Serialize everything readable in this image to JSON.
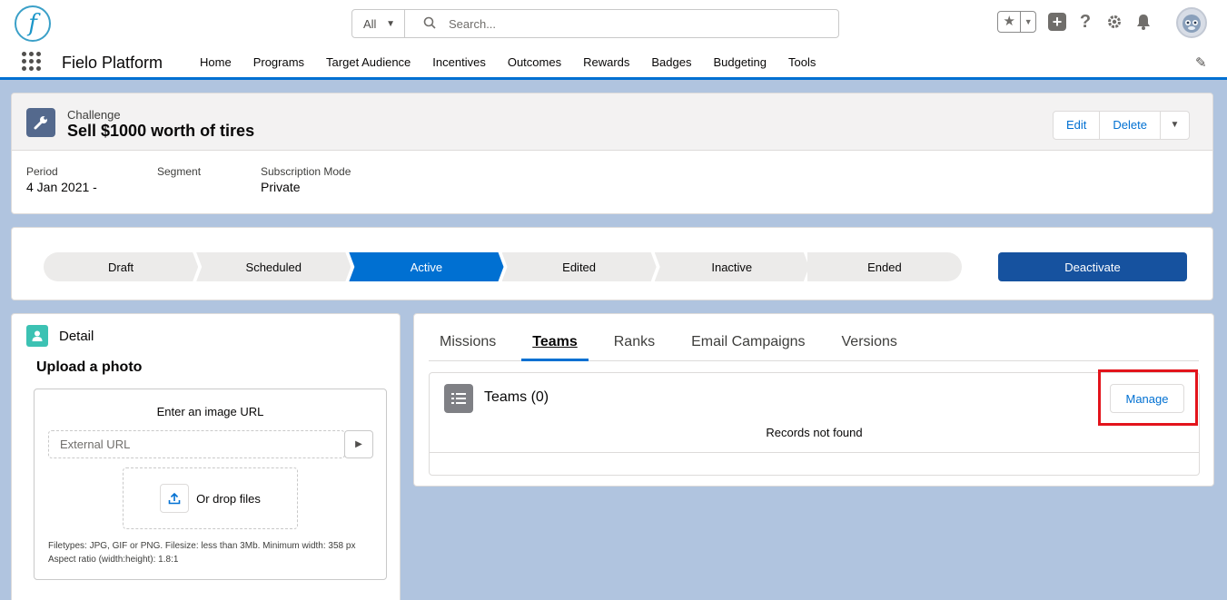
{
  "header": {
    "logo_letter": "f",
    "search_scope": "All",
    "search_placeholder": "Search...",
    "help_glyph": "?"
  },
  "nav": {
    "app_name": "Fielo Platform",
    "items": [
      "Home",
      "Programs",
      "Target Audience",
      "Incentives",
      "Outcomes",
      "Rewards",
      "Badges",
      "Budgeting",
      "Tools"
    ]
  },
  "record": {
    "object_type": "Challenge",
    "title": "Sell $1000 worth of tires",
    "buttons": {
      "edit": "Edit",
      "delete": "Delete"
    },
    "fields": {
      "period_label": "Period",
      "period_value": "4 Jan 2021 -",
      "segment_label": "Segment",
      "segment_value": "",
      "subscription_label": "Subscription Mode",
      "subscription_value": "Private"
    }
  },
  "path": {
    "stages": [
      "Draft",
      "Scheduled",
      "Active",
      "Edited",
      "Inactive",
      "Ended"
    ],
    "active_stage": "Active",
    "action_label": "Deactivate"
  },
  "detail": {
    "title": "Detail",
    "upload_title": "Upload a photo",
    "image_url_label": "Enter an image URL",
    "url_placeholder": "External URL",
    "drop_text": "Or drop files",
    "hint_line1": "Filetypes: JPG, GIF or PNG. Filesize: less than 3Mb. Minimum width: 358 px",
    "hint_line2": "Aspect ratio (width:height): 1.8:1"
  },
  "tabs": {
    "items": [
      "Missions",
      "Teams",
      "Ranks",
      "Email Campaigns",
      "Versions"
    ],
    "active": "Teams"
  },
  "related": {
    "title": "Teams (0)",
    "manage_label": "Manage",
    "empty_text": "Records not found"
  },
  "colors": {
    "brand_blue": "#0070d2",
    "dark_blue": "#16529f",
    "highlight_red": "#e3141c",
    "background": "#b0c4df"
  }
}
